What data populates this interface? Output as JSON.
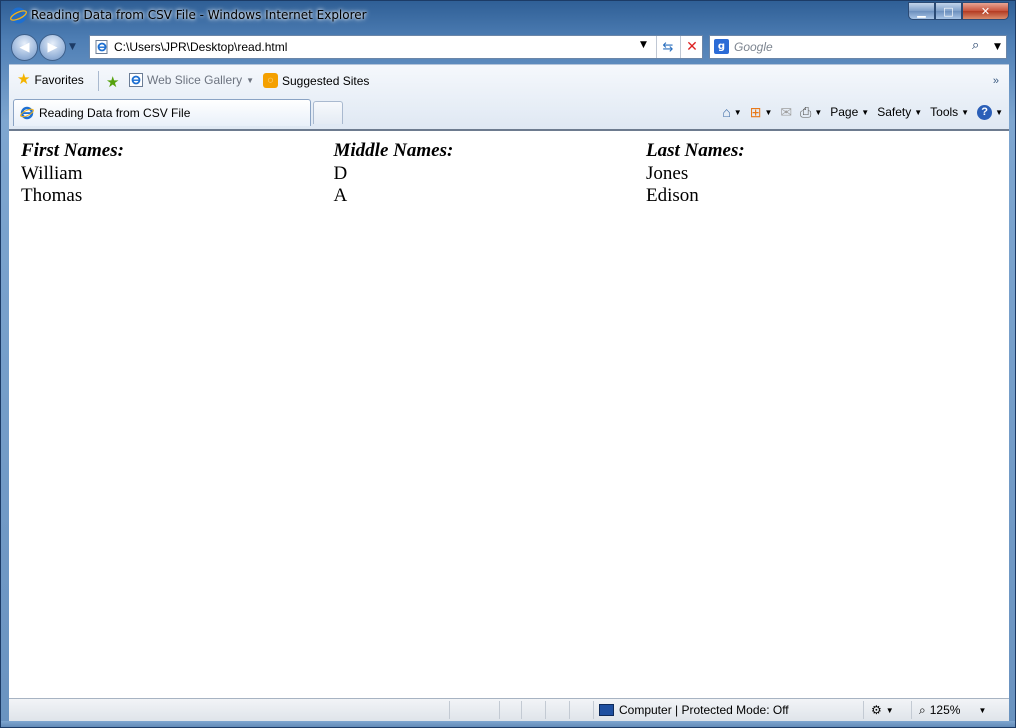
{
  "window": {
    "title": "Reading Data from CSV File - Windows Internet Explorer",
    "controls": {
      "minimize": "▁",
      "maximize": "□",
      "close": "✕"
    }
  },
  "navigation": {
    "address": "C:\\Users\\JPR\\Desktop\\read.html",
    "search_placeholder": "Google",
    "search_engine_letter": "g"
  },
  "favorites_bar": {
    "favorites_label": "Favorites",
    "items": [
      "Web Slice Gallery",
      "Suggested Sites"
    ]
  },
  "tab": {
    "label": "Reading Data from CSV File"
  },
  "command_bar": {
    "page": "Page",
    "safety": "Safety",
    "tools": "Tools"
  },
  "page": {
    "headers": [
      "First Names:",
      "Middle Names:",
      "Last Names:"
    ],
    "rows": [
      [
        "William",
        "D",
        "Jones"
      ],
      [
        "Thomas",
        "A",
        "Edison"
      ]
    ]
  },
  "status_bar": {
    "zone": "Computer | Protected Mode: Off",
    "zoom": "125%"
  },
  "icons": {
    "browser": "ie-icon",
    "home": "home-icon",
    "feeds": "rss-icon",
    "mail": "mail-icon",
    "print": "print-icon",
    "help": "help-icon"
  }
}
